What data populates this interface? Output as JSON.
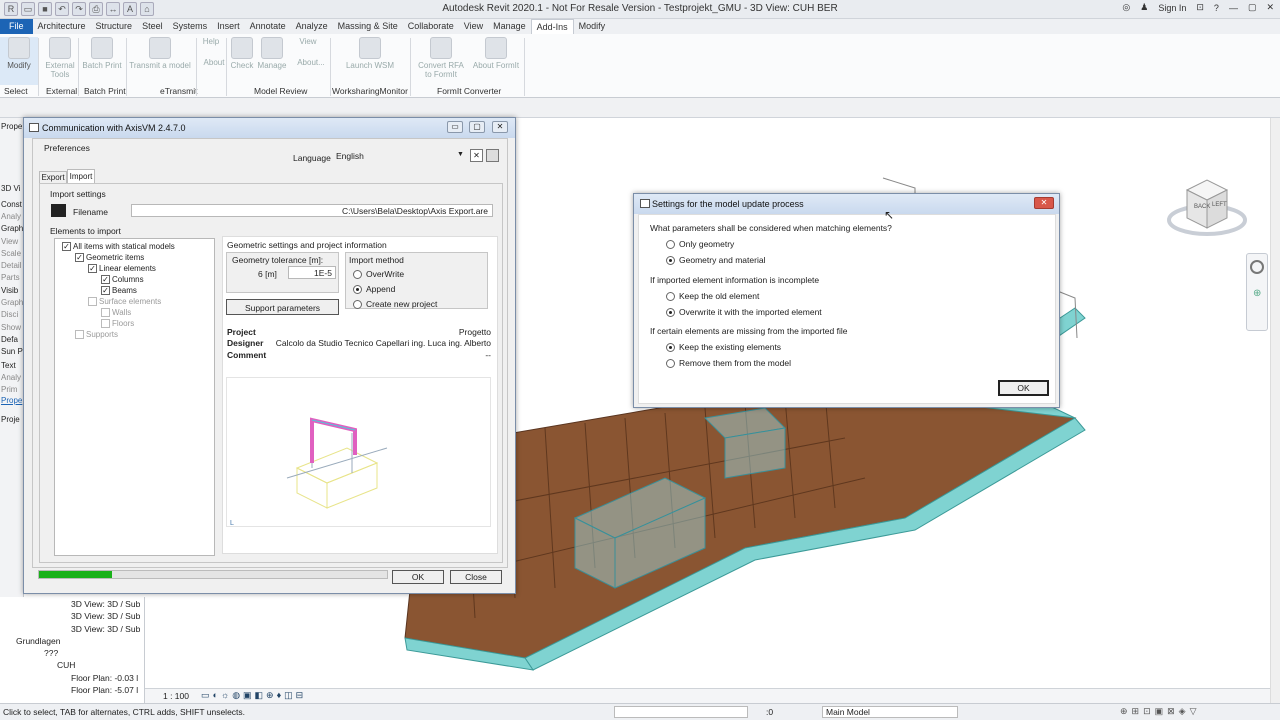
{
  "app": {
    "title": "Autodesk Revit 2020.1 - Not For Resale Version - Testprojekt_GMU - 3D View: CUH BER",
    "sign_in": "Sign In"
  },
  "ribbon_tabs": [
    "File",
    "Architecture",
    "Structure",
    "Steel",
    "Systems",
    "Insert",
    "Annotate",
    "Analyze",
    "Massing & Site",
    "Collaborate",
    "View",
    "Manage",
    "Add-Ins",
    "Modify"
  ],
  "ribbon": {
    "buttons": [
      {
        "label": "Modify"
      },
      {
        "label": "External Tools"
      },
      {
        "label": "Batch Print"
      },
      {
        "label": "Transmit a model"
      },
      {
        "label": "Help"
      },
      {
        "label": "About"
      },
      {
        "label": "Check"
      },
      {
        "label": "Manage"
      },
      {
        "label": "View"
      },
      {
        "label": "About..."
      },
      {
        "label": "Launch WSM"
      },
      {
        "label": "Convert RFA to FormIt"
      },
      {
        "label": "About FormIt"
      }
    ],
    "groups": [
      "Select",
      "External",
      "Batch Print",
      "eTransmit",
      "Model Review",
      "WorksharingMonitor",
      "FormIt Converter"
    ]
  },
  "left_panel": {
    "labels": [
      "Prope",
      "3D Vi",
      "Const",
      "Analy",
      "Graph",
      "View",
      "Scale",
      "Detail",
      "Parts",
      "Visib",
      "Graph",
      "Disci",
      "Show",
      "Defa",
      "Sun P",
      "Text",
      "Analy",
      "Prim",
      "Prope",
      "Proje"
    ]
  },
  "project_browser": {
    "items": [
      "3D View: 3D / Sub",
      "3D View: 3D / Sub",
      "3D View: 3D / Sub",
      "Grundlagen",
      "???",
      "CUH",
      "Floor Plan: -0.03 l",
      "Floor Plan: -5.07 l"
    ]
  },
  "axis_dialog": {
    "title": "Communication with AxisVM 2.4.7.0",
    "preferences": "Preferences",
    "language_label": "Language",
    "language_value": "English",
    "tabs": [
      "Export",
      "Import"
    ],
    "import_settings": "Import settings",
    "filename_label": "Filename",
    "filename_value": "C:\\Users\\Bela\\Desktop\\Axis Export.are",
    "elements_to_import": "Elements to import",
    "tree": [
      {
        "label": "All items with statical models",
        "checked": true,
        "level": 0
      },
      {
        "label": "Geometric items",
        "checked": true,
        "level": 1
      },
      {
        "label": "Linear elements",
        "checked": true,
        "level": 2
      },
      {
        "label": "Columns",
        "checked": true,
        "level": 3
      },
      {
        "label": "Beams",
        "checked": true,
        "level": 3
      },
      {
        "label": "Surface elements",
        "checked": false,
        "level": 2
      },
      {
        "label": "Walls",
        "checked": false,
        "level": 3
      },
      {
        "label": "Floors",
        "checked": false,
        "level": 3
      },
      {
        "label": "Supports",
        "checked": false,
        "level": 1
      }
    ],
    "geom_section": "Geometric settings and project information",
    "tolerance_label": "Geometry tolerance [m]:",
    "tolerance_exp_label": "6 [m]",
    "tolerance_value": "1E-5",
    "import_method": "Import method",
    "methods": [
      {
        "label": "OverWrite",
        "selected": false
      },
      {
        "label": "Append",
        "selected": true
      },
      {
        "label": "Create new project",
        "selected": false
      }
    ],
    "support_params_button": "Support parameters",
    "project_label": "Project",
    "project_value": "Progetto",
    "designer_label": "Designer",
    "designer_value": "Calcolo da Studio Tecnico Capellari ing. Luca  ing. Alberto",
    "comment_label": "Comment",
    "comment_value": "--",
    "progress": 0.21,
    "ok": "OK",
    "close": "Close"
  },
  "settings_dialog": {
    "title": "Settings for the model update process",
    "q1": "What parameters shall be considered when matching elements?",
    "q1_options": [
      {
        "label": "Only geometry",
        "selected": false
      },
      {
        "label": "Geometry and material",
        "selected": true
      }
    ],
    "q2": "If imported element information is incomplete",
    "q2_options": [
      {
        "label": "Keep the old element",
        "selected": false
      },
      {
        "label": "Overwrite it with the imported element",
        "selected": true
      }
    ],
    "q3": "If certain elements are missing from the imported file",
    "q3_options": [
      {
        "label": "Keep the existing elements",
        "selected": true
      },
      {
        "label": "Remove them from the model",
        "selected": false
      }
    ],
    "ok": "OK"
  },
  "viewcube": {
    "faces": [
      "BACK",
      "LEFT"
    ]
  },
  "view_bar": {
    "scale": "1 : 100"
  },
  "status_bar": {
    "message": "Click to select, TAB for alternates, CTRL adds, SHIFT unselects.",
    "model": "Main Model",
    "zero": ":0"
  },
  "colors": {
    "brand": "#1c64b5",
    "steel": "#7fd3d1",
    "floor": "#8a5532",
    "progress": "#19b119"
  }
}
